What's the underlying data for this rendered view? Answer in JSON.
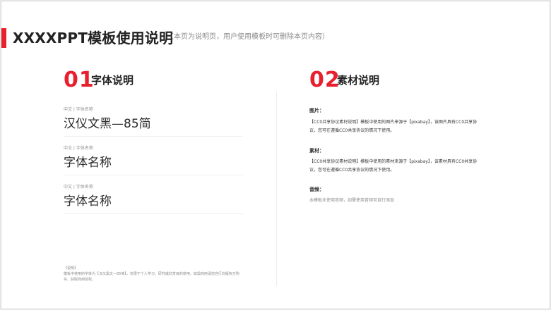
{
  "header": {
    "title": "XXXXPPT模板使用说明",
    "note": "（本页为说明页，用户使用模板时可删除本页内容）",
    "accent_color": "#e8202e"
  },
  "section_font": {
    "number": "01",
    "title": "字体说明",
    "items": [
      {
        "caption": "中文 | 字体名称",
        "name": "汉仪文黑—85简"
      },
      {
        "caption": "中文 | 字体名称",
        "name": "字体名称"
      },
      {
        "caption": "中文 | 字体名称",
        "name": "字体名称"
      }
    ],
    "note": {
      "label": "【说明】",
      "text": "模板中使用的字体为【汉仪黑文—85简】，仅限于个人学习、研究或欣赏目的使用。如需商用请您自行向版权方购买、获取商用授权。"
    }
  },
  "section_material": {
    "number": "02",
    "title": "素材说明",
    "blocks": [
      {
        "heading": "图片：",
        "text": "【CC0共享协议素材说明】模板中使用的图片来源于【pixabay】，该图片具有CC0共享协议，您可在遵循CC0共享协议的情况下使用。"
      },
      {
        "heading": "素材：",
        "text": "【CC0共享协议素材说明】模板中使用的素材来源于【pixabay】，该素材具有CC0共享协议，您可在遵循CC0共享协议的情况下使用。"
      },
      {
        "heading": "音频：",
        "text": "本模板未使用音频，如需使用音频可自行添加"
      }
    ]
  }
}
